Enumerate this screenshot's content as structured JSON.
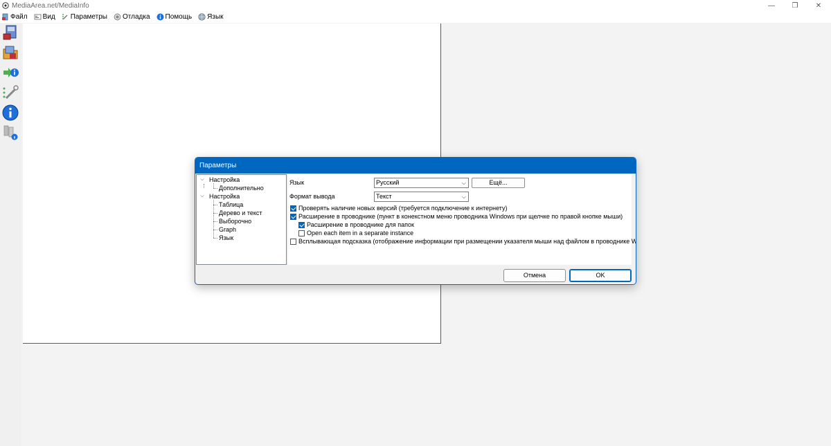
{
  "window": {
    "title": "MediaArea.net/MediaInfo",
    "controls": {
      "minimize": "—",
      "maximize": "❐",
      "close": "✕"
    }
  },
  "menu": [
    {
      "label": "Файл",
      "icon": "file-icon"
    },
    {
      "label": "Вид",
      "icon": "view-icon"
    },
    {
      "label": "Параметры",
      "icon": "options-icon"
    },
    {
      "label": "Отладка",
      "icon": "debug-icon"
    },
    {
      "label": "Помощь",
      "icon": "help-icon"
    },
    {
      "label": "Язык",
      "icon": "language-icon"
    }
  ],
  "toolbar": [
    "open-file-icon",
    "open-folder-icon",
    "export-icon",
    "preferences-icon",
    "about-icon",
    "knowledge-base-icon"
  ],
  "dialog": {
    "title": "Параметры",
    "tree": {
      "item1": "Настройка",
      "item1_child": "Дополнительно",
      "item2": "Настройка",
      "item2_children": [
        "Таблица",
        "Дерево и текст",
        "Выборочно",
        "Graph",
        "Язык"
      ]
    },
    "language_label": "Язык",
    "language_value": "Русский",
    "more_button": "Ещё...",
    "output_format_label": "Формат вывода",
    "output_format_value": "Текст",
    "checkboxes": [
      {
        "label": "Проверять наличие новых версий (требуется подключение к интернету)",
        "checked": true
      },
      {
        "label": "Расширение в проводнике (пункт в конекстном меню проводника Windows при щелчке по правой кнопке мыши)",
        "checked": true
      },
      {
        "label": "Расширение в проводнике для папок",
        "checked": true
      },
      {
        "label": "Open each item in a separate instance",
        "checked": false
      },
      {
        "label": "Всплывающая подсказка (отображение информации при размещении указателя мыши над файлом в проводнике Windows)",
        "checked": false
      }
    ],
    "cancel_button": "Отмена",
    "ok_button": "OK"
  },
  "colors": {
    "accent": "#0067c0"
  }
}
